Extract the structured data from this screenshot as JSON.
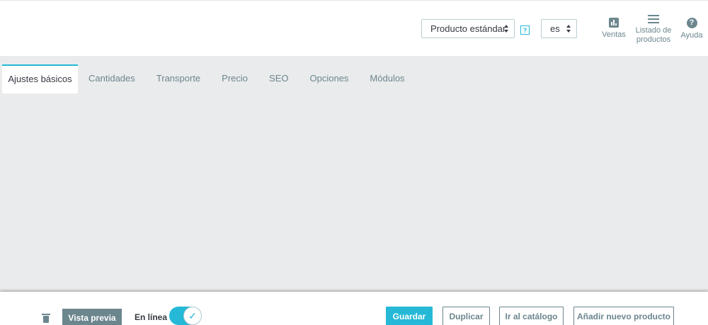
{
  "header": {
    "product_type": "Producto estándar",
    "help_mark": "?",
    "language": "es",
    "toolbar": {
      "sales_label": "Ventas",
      "list_label_1": "Listado de",
      "list_label_2": "productos",
      "help_label": "Ayuda",
      "help_icon_glyph": "?"
    }
  },
  "tabs": [
    {
      "label": "Ajustes básicos"
    },
    {
      "label": "Cantidades"
    },
    {
      "label": "Transporte"
    },
    {
      "label": "Precio"
    },
    {
      "label": "SEO"
    },
    {
      "label": "Opciones"
    },
    {
      "label": "Módulos"
    }
  ],
  "footer": {
    "preview_label": "Vista previa",
    "online_label": "En línea",
    "toggle_check": "✓",
    "save_label": "Guardar",
    "duplicate_label": "Duplicar",
    "catalog_label": "Ir al catálogo",
    "add_new_label": "Añadir nuevo producto"
  },
  "colors": {
    "accent": "#25b9d7",
    "muted": "#6c868e",
    "content_bg": "#eaebec"
  }
}
